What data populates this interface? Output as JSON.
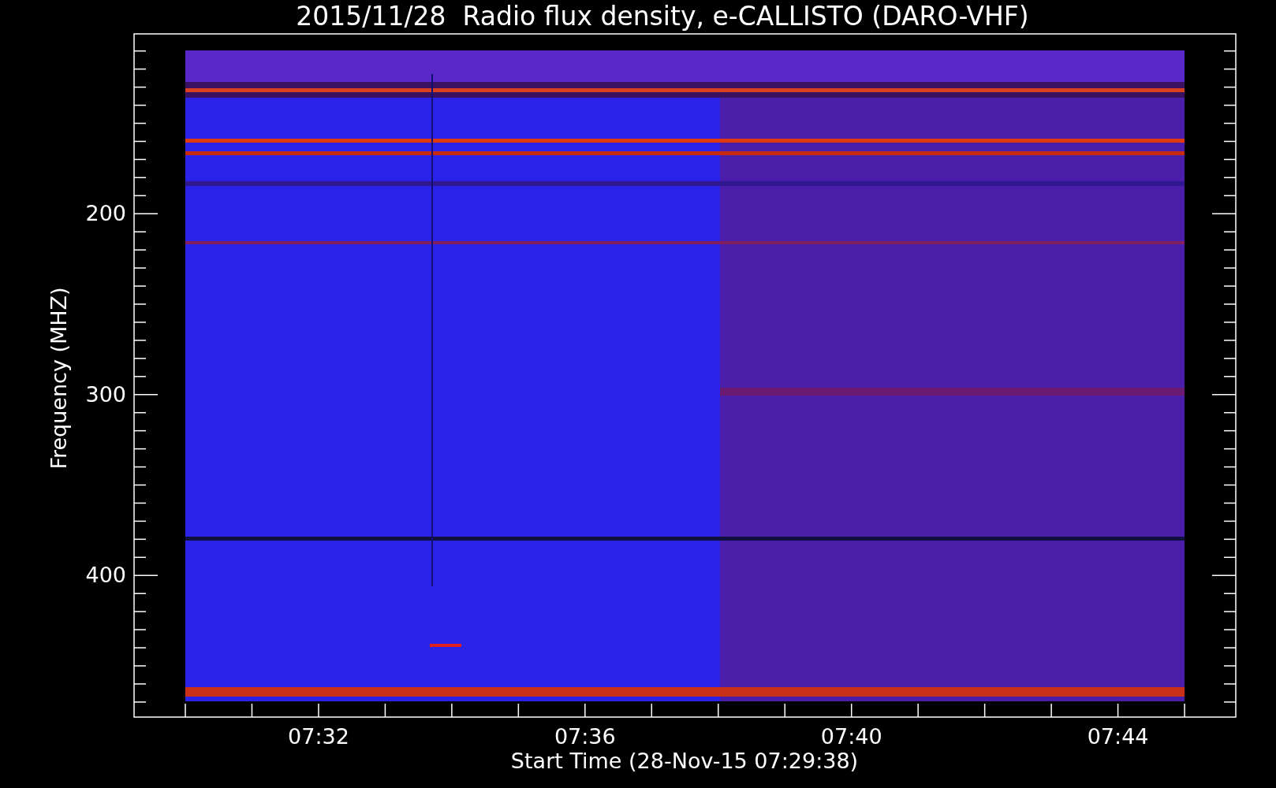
{
  "title": "2015/11/28  Radio flux density, e-CALLISTO (DARO-VHF)",
  "plot": {
    "ylabel": "Frequency (MHZ)",
    "xlabel": "Start Time (28-Nov-15 07:29:38)",
    "yticks": [
      "200",
      "300",
      "400"
    ],
    "xticks": [
      "07:32",
      "07:36",
      "07:40",
      "07:44"
    ]
  }
}
